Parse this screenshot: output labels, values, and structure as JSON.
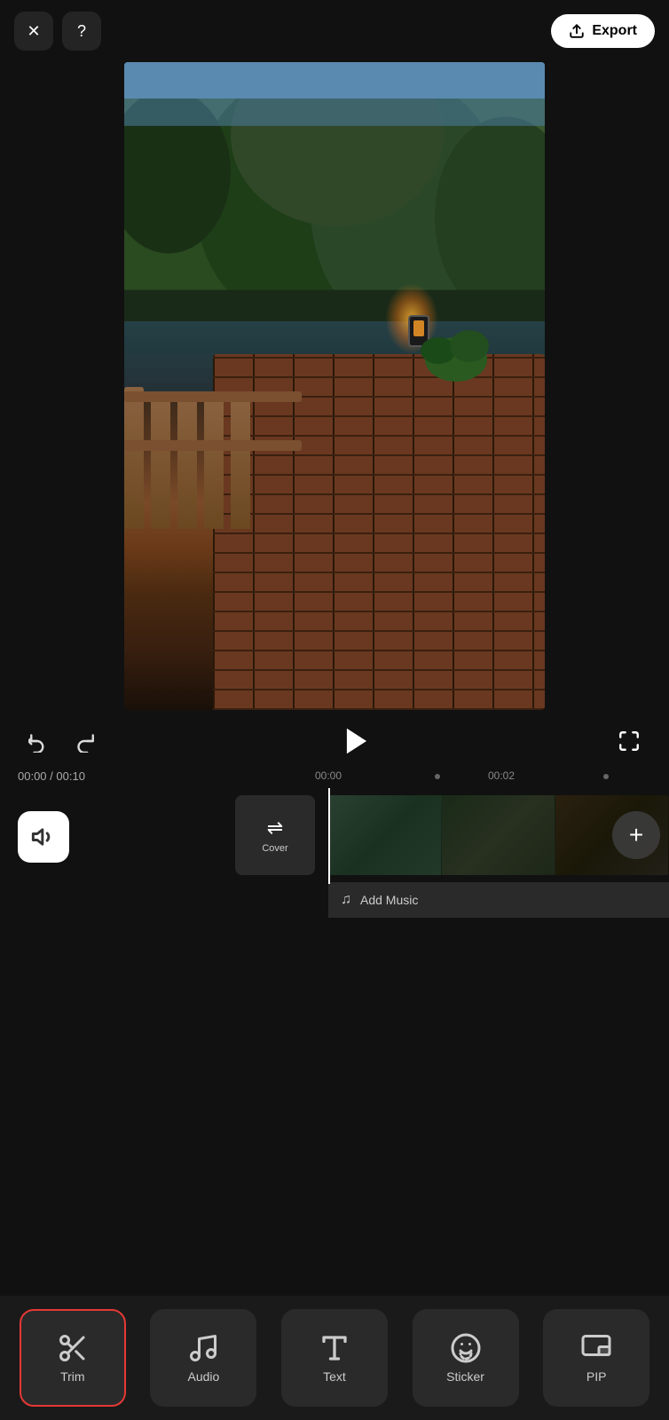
{
  "header": {
    "close_label": "✕",
    "help_label": "?",
    "export_label": "Export"
  },
  "controls": {
    "undo_label": "↩",
    "redo_label": "↪",
    "play_label": "▶",
    "fullscreen_label": "⛶"
  },
  "timeline": {
    "current_time": "00:00",
    "total_time": "00:10",
    "marker_00": "00:00",
    "marker_02": "00:02",
    "cover_label": "Cover",
    "add_music_label": "Add Music",
    "add_clip_label": "+"
  },
  "toolbar": {
    "items": [
      {
        "id": "trim",
        "label": "Trim",
        "icon": "✂"
      },
      {
        "id": "audio",
        "label": "Audio",
        "icon": "♪"
      },
      {
        "id": "text",
        "label": "Text",
        "icon": "T"
      },
      {
        "id": "sticker",
        "label": "Sticker",
        "icon": "◉"
      },
      {
        "id": "pip",
        "label": "PIP",
        "icon": "⧉"
      }
    ],
    "active": "trim"
  }
}
